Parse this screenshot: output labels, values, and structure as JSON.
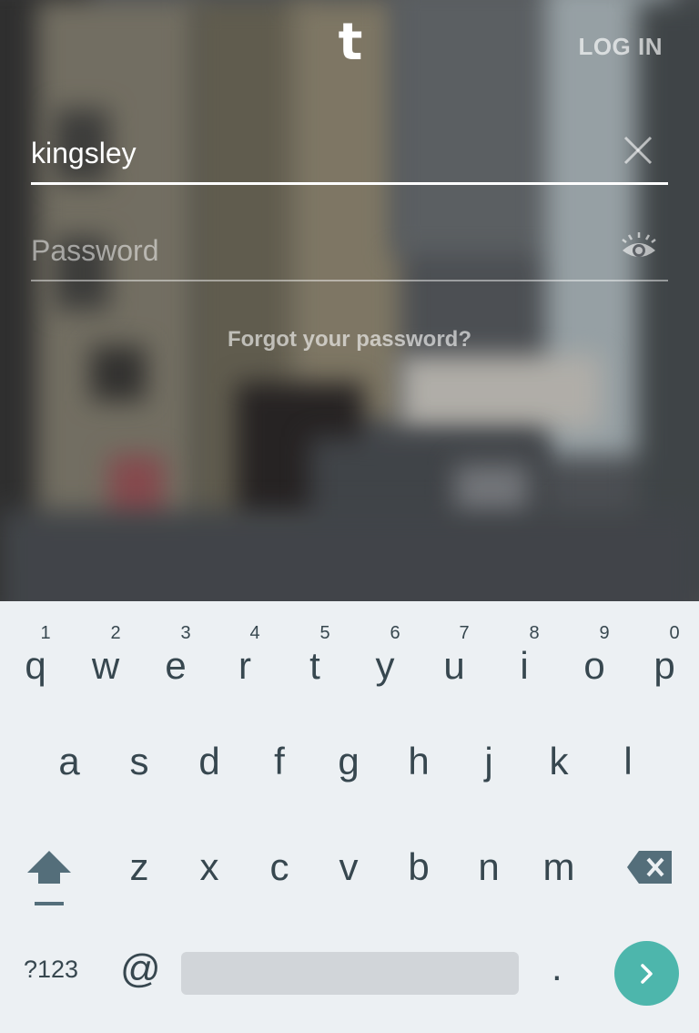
{
  "app": {
    "logo_letter": "t",
    "login_label": "LOG IN"
  },
  "form": {
    "username_value": "kingsley",
    "password_placeholder": "Password",
    "forgot_label": "Forgot your password?"
  },
  "icons": {
    "clear": "close-icon",
    "reveal_password": "eye-icon",
    "shift": "shift-arrow-icon",
    "backspace": "backspace-icon",
    "enter": "chevron-right-icon"
  },
  "colors": {
    "keyboard_bg": "#ecf0f3",
    "key_text": "#37474f",
    "enter_accent": "#4db6ac",
    "space_bar": "#d1d5d9"
  },
  "keyboard": {
    "row1": [
      {
        "ch": "q",
        "hint": "1"
      },
      {
        "ch": "w",
        "hint": "2"
      },
      {
        "ch": "e",
        "hint": "3"
      },
      {
        "ch": "r",
        "hint": "4"
      },
      {
        "ch": "t",
        "hint": "5"
      },
      {
        "ch": "y",
        "hint": "6"
      },
      {
        "ch": "u",
        "hint": "7"
      },
      {
        "ch": "i",
        "hint": "8"
      },
      {
        "ch": "o",
        "hint": "9"
      },
      {
        "ch": "p",
        "hint": "0"
      }
    ],
    "row2": [
      "a",
      "s",
      "d",
      "f",
      "g",
      "h",
      "j",
      "k",
      "l"
    ],
    "row3": [
      "z",
      "x",
      "c",
      "v",
      "b",
      "n",
      "m"
    ],
    "symbols_label": "?123",
    "at_label": "@",
    "period_label": "."
  }
}
